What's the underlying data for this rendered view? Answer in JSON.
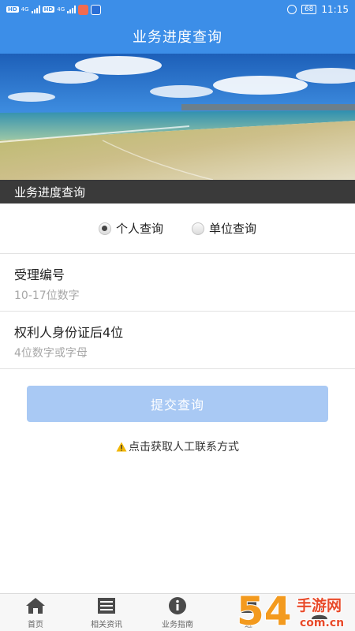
{
  "status_bar": {
    "network": "4G",
    "network2": "4G",
    "battery": "68",
    "time": "11:15",
    "hd": "HD"
  },
  "header": {
    "title": "业务进度查询"
  },
  "banner": {
    "caption": "业务进度查询",
    "image": "beach-photo"
  },
  "query_type": {
    "options": [
      {
        "label": "个人查询",
        "checked": true
      },
      {
        "label": "单位查询",
        "checked": false
      }
    ]
  },
  "form": {
    "acceptance_number": {
      "label": "受理编号",
      "placeholder": "10-17位数字"
    },
    "id_last4": {
      "label": "权利人身份证后4位",
      "placeholder": "4位数字或字母"
    },
    "submit_label": "提交查询"
  },
  "contact": {
    "text": "点击获取人工联系方式",
    "icon": "warning-icon"
  },
  "bottom_nav": {
    "items": [
      {
        "label": "首页",
        "icon": "home-icon"
      },
      {
        "label": "相关资讯",
        "icon": "news-icon"
      },
      {
        "label": "业务指南",
        "icon": "info-icon"
      },
      {
        "label": "进",
        "icon": "progress-icon"
      },
      {
        "label": "",
        "icon": "user-icon"
      }
    ]
  },
  "watermark": {
    "text1": "54",
    "text2": "手游网",
    "text3": "com.cn"
  },
  "colors": {
    "primary": "#3c8ee8",
    "button_disabled": "#a9c9f4",
    "caption_bg": "#3a3a3a"
  }
}
